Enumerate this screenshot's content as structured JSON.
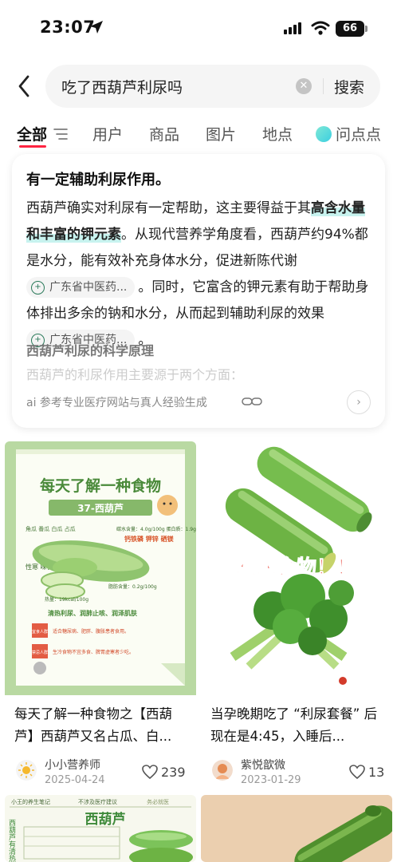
{
  "status": {
    "time": "23:07",
    "battery": "66"
  },
  "search": {
    "query": "吃了西葫芦利尿吗",
    "button": "搜索"
  },
  "tabs": [
    {
      "label": "全部",
      "active": true
    },
    {
      "label": "用户"
    },
    {
      "label": "商品"
    },
    {
      "label": "图片"
    },
    {
      "label": "地点"
    },
    {
      "label": "问点点"
    }
  ],
  "ai": {
    "heading": "有一定辅助利尿作用。",
    "p1": "西葫芦确实对利尿有一定帮助，这主要得益于其",
    "p1_hl": "高含水量和丰富的钾元素",
    "p2": "。从现代营养学角度看，西葫芦约94%都是水分，能有效补充身体水分，促进新陈代谢",
    "p3": "。同时，它富含的钾元素有助于帮助身体排出多余的钠和水分，从而起到辅助利尿的效果",
    "p4": "。",
    "source": "广东省中医药...",
    "subheading": "西葫芦利尿的科学原理",
    "fade": "西葫芦的利尿作用主要源于两个方面：",
    "footer": "ai 参考专业医疗网站与真人经验生成"
  },
  "notes": [
    {
      "title": "每天了解一种食物之【西葫芦】西葫芦又名占瓜、白...",
      "author": "小小营养师",
      "date": "2025-04-24",
      "likes": "239",
      "image": {
        "heading": "每天了解一种食物",
        "banner": "37-西葫芦",
        "names": "角瓜  番瓜  白瓜  占瓜",
        "side": "性寒 味甘",
        "nutrition": "碳水含量：4.0g/100g  蛋白质：1.9g/100g",
        "minerals": "钙铁磷 钾锌 硒镁",
        "fat": "脂肪含量：0.2g/100g",
        "kcal": "热量：19kcal/100g",
        "effects": "清热利尿、润肺止咳、润泽肌肤",
        "suitable": "宜食人群",
        "suitable_text": "适合糖尿病、肥胖、腹胀患者食用。",
        "caution": "禁忌人群",
        "caution_text": "生冷食物不宜多食、脾胃虚寒者少吃。"
      }
    },
    {
      "title": "当孕晚期吃了 “利尿套餐” 后 现在是4:45，入睡后...",
      "author": "紫悦歆微",
      "date": "2023-01-29",
      "likes": "13",
      "image": {
        "overlay": "利尿食物！！"
      }
    },
    {
      "image": {
        "header": "小王的养生笔记",
        "header2": "不涉及医疗建议",
        "header3": "务必就医",
        "title": "西葫芦",
        "side": "西葫芦有清热"
      }
    },
    {
      "image": {}
    }
  ],
  "colors": {
    "accent": "#ff2442",
    "ai_highlight": "#c8f3ef",
    "zucchini": "#7cc35a"
  }
}
